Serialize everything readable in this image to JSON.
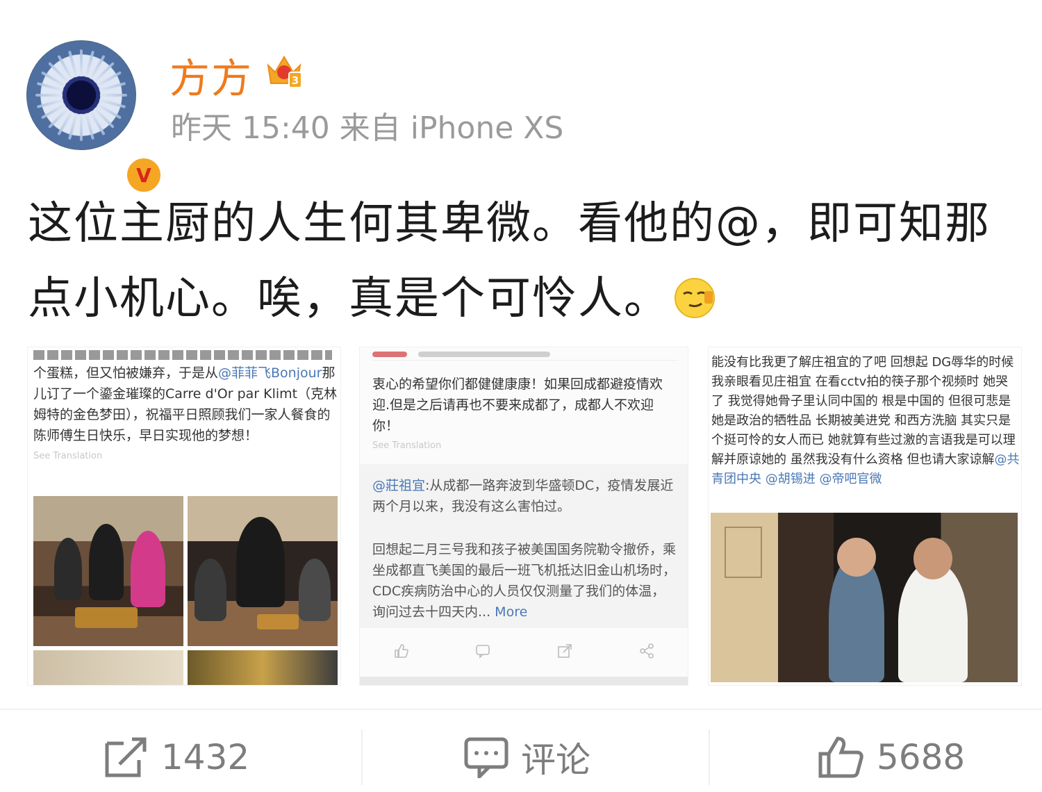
{
  "post": {
    "author": "方方",
    "meta": "昨天 15:40 来自 iPhone XS",
    "text_line1": "这位主厨的人生何其卑微。看他的@，即可知那",
    "text_line2": "点小机心。唉，真是个可怜人。",
    "verified_mark": "V",
    "member_level": "3",
    "emoji": "smirk-face-icon"
  },
  "screenshots": {
    "s1": {
      "text_a": "个蛋糕，但又怕被嫌弃，于是从",
      "mention": "@菲菲飞Bonjour",
      "text_b": "那儿订了一个鎏金璀璨的Carre d'Or par Klimt（克林姆特的金色梦田），祝福平日照顾我们一家人餐食的陈师傅生日快乐，早日实现他的梦想！",
      "see_translation": "See Translation"
    },
    "s2": {
      "text": "衷心的希望你们都健健康康！如果回成都避疫情欢迎.但是之后请再也不要来成都了，成都人不欢迎你！",
      "see_translation": "See Translation",
      "quote_mention": "@莊祖宜",
      "quote_text1": ":从成都一路奔波到华盛顿DC，疫情发展近两个月以来，我没有这么害怕过。",
      "quote_text2": "回想起二月三号我和孩子被美国国务院勒令撤侨，乘坐成都直飞美国的最后一班飞机抵达旧金山机场时，CDC疾病防治中心的人员仅仅测量了我们的体温，询问过去十四天内...",
      "more": "More"
    },
    "s3": {
      "text": "能没有比我更了解庄祖宜的了吧 回想起 DG辱华的时候 我亲眼看见庄祖宜 在看cctv拍的筷子那个视频时 她哭了 我觉得她骨子里认同中国的 根是中国的 但很可悲是 她是政治的牺牲品 长期被美进党 和西方洗脑 其实只是个挺可怜的女人而已 她就算有些过激的言语我是可以理解并原谅她的 虽然我没有什么资格 但也请大家谅解",
      "mentions": "@共青团中央 @胡锡进 @帝吧官微"
    },
    "s4": {}
  },
  "actions": {
    "repost_count": "1432",
    "comment_label": "评论",
    "like_count": "5688"
  },
  "colors": {
    "username": "#ef7a1c",
    "meta": "#9a9a9a",
    "link": "#4a78b5",
    "action": "#7d7d7d"
  }
}
